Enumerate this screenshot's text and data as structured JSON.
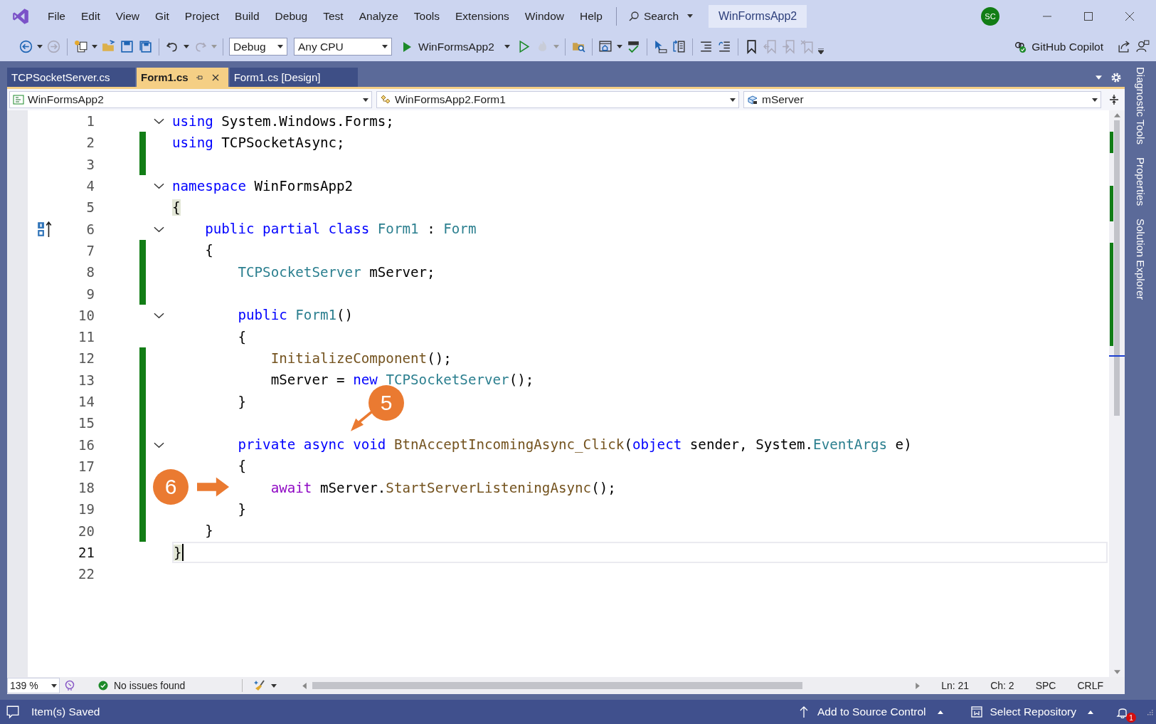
{
  "menu": [
    "File",
    "Edit",
    "View",
    "Git",
    "Project",
    "Build",
    "Debug",
    "Test",
    "Analyze",
    "Tools",
    "Extensions",
    "Window",
    "Help"
  ],
  "search": {
    "label": "Search"
  },
  "window": {
    "title": "WinFormsApp2",
    "avatar": "SC"
  },
  "toolbar": {
    "configuration": "Debug",
    "platform": "Any CPU",
    "run_target": "WinFormsApp2",
    "copilot": "GitHub Copilot"
  },
  "tabs": [
    {
      "label": "TCPSocketServer.cs",
      "selected": false,
      "pinned": false
    },
    {
      "label": "Form1.cs",
      "selected": true,
      "pinned": true
    },
    {
      "label": "Form1.cs [Design]",
      "selected": false,
      "pinned": false
    }
  ],
  "nav_bar": {
    "project": "WinFormsApp2",
    "type": "WinFormsApp2.Form1",
    "member": "mServer"
  },
  "side_panels": [
    "Diagnostic Tools",
    "Properties",
    "Solution Explorer"
  ],
  "code": {
    "lines": [
      {
        "number": "1",
        "foldable": true,
        "changed": false,
        "current": false,
        "tokens": [
          {
            "kind": "kw",
            "text": "using"
          },
          {
            "kind": "text",
            "text": " System.Windows.Forms;"
          }
        ]
      },
      {
        "number": "2",
        "foldable": false,
        "changed": true,
        "current": false,
        "tokens": [
          {
            "kind": "kw",
            "text": "using"
          },
          {
            "kind": "text",
            "text": " TCPSocketAsync;"
          }
        ]
      },
      {
        "number": "3",
        "foldable": false,
        "changed": true,
        "current": false
      },
      {
        "number": "4",
        "foldable": true,
        "changed": false,
        "current": false,
        "tokens": [
          {
            "kind": "kw",
            "text": "namespace"
          },
          {
            "kind": "text",
            "text": " WinFormsApp2"
          }
        ]
      },
      {
        "number": "5",
        "foldable": false,
        "changed": false,
        "current": false,
        "tokens": [
          {
            "kind": "brace",
            "text": "{"
          }
        ]
      },
      {
        "number": "6",
        "foldable": true,
        "changed": false,
        "current": false,
        "marker": true,
        "tokens": [
          {
            "kind": "kw",
            "text": "    public partial class "
          },
          {
            "kind": "type",
            "text": "Form1"
          },
          {
            "kind": "text",
            "text": " : "
          },
          {
            "kind": "type",
            "text": "Form"
          }
        ]
      },
      {
        "number": "7",
        "foldable": false,
        "changed": true,
        "current": false,
        "tokens": [
          {
            "kind": "text",
            "text": "    {"
          }
        ]
      },
      {
        "number": "8",
        "foldable": false,
        "changed": true,
        "current": false,
        "tokens": [
          {
            "kind": "type",
            "text": "        TCPSocketServer"
          },
          {
            "kind": "text",
            "text": " mServer;"
          }
        ]
      },
      {
        "number": "9",
        "foldable": false,
        "changed": true,
        "current": false
      },
      {
        "number": "10",
        "foldable": true,
        "changed": false,
        "current": false,
        "tokens": [
          {
            "kind": "kw",
            "text": "        public "
          },
          {
            "kind": "type",
            "text": "Form1"
          },
          {
            "kind": "text",
            "text": "()"
          }
        ]
      },
      {
        "number": "11",
        "foldable": false,
        "changed": false,
        "current": false,
        "tokens": [
          {
            "kind": "text",
            "text": "        {"
          }
        ]
      },
      {
        "number": "12",
        "foldable": false,
        "changed": true,
        "current": false,
        "tokens": [
          {
            "kind": "method",
            "text": "            InitializeComponent"
          },
          {
            "kind": "text",
            "text": "();"
          }
        ]
      },
      {
        "number": "13",
        "foldable": false,
        "changed": true,
        "current": false,
        "tokens": [
          {
            "kind": "text",
            "text": "            mServer = "
          },
          {
            "kind": "kw",
            "text": "new "
          },
          {
            "kind": "type",
            "text": "TCPSocketServer"
          },
          {
            "kind": "text",
            "text": "();"
          }
        ]
      },
      {
        "number": "14",
        "foldable": false,
        "changed": true,
        "current": false,
        "tokens": [
          {
            "kind": "text",
            "text": "        }"
          }
        ]
      },
      {
        "number": "15",
        "foldable": false,
        "changed": true,
        "current": false
      },
      {
        "number": "16",
        "foldable": true,
        "changed": true,
        "current": false,
        "tokens": [
          {
            "kind": "kw",
            "text": "        private async void "
          },
          {
            "kind": "method",
            "text": "BtnAcceptIncomingAsync_Click"
          },
          {
            "kind": "text",
            "text": "("
          },
          {
            "kind": "kw",
            "text": "object"
          },
          {
            "kind": "text",
            "text": " sender, System."
          },
          {
            "kind": "type",
            "text": "EventArgs"
          },
          {
            "kind": "text",
            "text": " e)"
          }
        ]
      },
      {
        "number": "17",
        "foldable": false,
        "changed": true,
        "current": false,
        "tokens": [
          {
            "kind": "text",
            "text": "        {"
          }
        ]
      },
      {
        "number": "18",
        "foldable": false,
        "changed": true,
        "current": false,
        "tokens": [
          {
            "kind": "ctrl",
            "text": "            await"
          },
          {
            "kind": "text",
            "text": " mServer."
          },
          {
            "kind": "method",
            "text": "StartServerListeningAsync"
          },
          {
            "kind": "text",
            "text": "();"
          }
        ]
      },
      {
        "number": "19",
        "foldable": false,
        "changed": true,
        "current": false,
        "tokens": [
          {
            "kind": "text",
            "text": "        }"
          }
        ]
      },
      {
        "number": "20",
        "foldable": false,
        "changed": true,
        "current": false,
        "tokens": [
          {
            "kind": "text",
            "text": "    }"
          }
        ]
      },
      {
        "number": "21",
        "foldable": false,
        "changed": false,
        "current": true,
        "tokens": [
          {
            "kind": "brace",
            "text": "}"
          }
        ]
      },
      {
        "number": "22",
        "foldable": false,
        "changed": false,
        "current": false
      }
    ]
  },
  "callouts": [
    {
      "number": "5",
      "kind": "diagonal"
    },
    {
      "number": "6",
      "kind": "horizontal"
    }
  ],
  "editor_footer": {
    "zoom": "139 %",
    "issues": "No issues found",
    "line": "Ln: 21",
    "column": "Ch: 2",
    "whitespace": "SPC",
    "line_ending": "CRLF"
  },
  "status_bar": {
    "message": "Item(s) Saved",
    "source_control": "Add to Source Control",
    "repository": "Select Repository",
    "notifications": "1"
  }
}
